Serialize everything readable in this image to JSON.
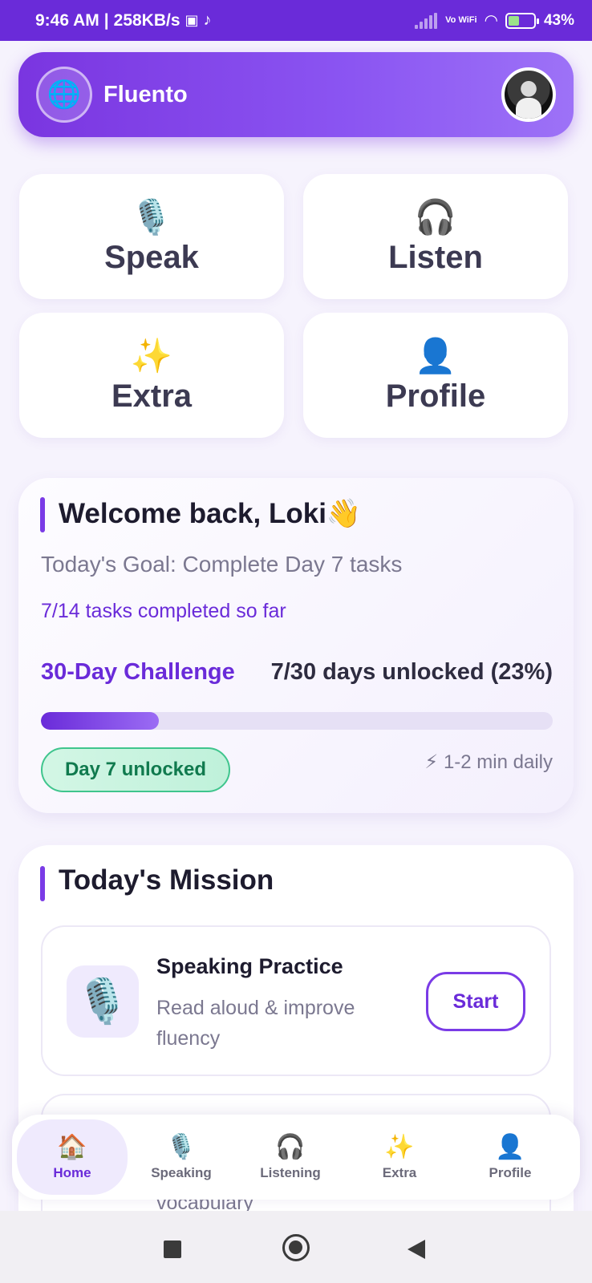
{
  "status_bar": {
    "time": "9:46 AM",
    "speed": "258KB/s",
    "network": "Vo WiFi",
    "battery": "43%",
    "battery_level": 0.43
  },
  "header": {
    "app_name": "Fluento",
    "logo_icon": "globe-icon",
    "avatar_icon": "user-avatar"
  },
  "quick_actions": [
    {
      "label": "Speak",
      "icon": "🎙️",
      "icon_name": "microphone-icon"
    },
    {
      "label": "Listen",
      "icon": "🎧",
      "icon_name": "headphones-icon"
    },
    {
      "label": "Extra",
      "icon": "✨",
      "icon_name": "sparkles-icon"
    },
    {
      "label": "Profile",
      "icon": "👤",
      "icon_name": "person-icon"
    }
  ],
  "welcome": {
    "title": "Welcome back, Loki👋",
    "goal": "Today's Goal: Complete Day 7 tasks",
    "tasks_done": "7/14 tasks completed so far",
    "challenge_label": "30-Day Challenge",
    "unlocked_text": "7/30 days unlocked (23%)",
    "progress": 0.23,
    "day_badge": "Day 7 unlocked",
    "daily_time": "⚡ 1-2 min daily"
  },
  "mission": {
    "title": "Today's Mission",
    "items": [
      {
        "name": "Speaking Practice",
        "desc": "Read aloud & improve fluency",
        "button": "Start",
        "icon": "🎙️",
        "icon_name": "microphone-icon"
      },
      {
        "name": "",
        "desc": "vocabulary",
        "button": "",
        "icon": "",
        "icon_name": ""
      }
    ]
  },
  "bottom_nav": [
    {
      "label": "Home",
      "icon": "🏠",
      "icon_name": "home-icon",
      "active": true
    },
    {
      "label": "Speaking",
      "icon": "🎙️",
      "icon_name": "microphone-icon",
      "active": false
    },
    {
      "label": "Listening",
      "icon": "🎧",
      "icon_name": "headphones-icon",
      "active": false
    },
    {
      "label": "Extra",
      "icon": "✨",
      "icon_name": "sparkles-icon",
      "active": false
    },
    {
      "label": "Profile",
      "icon": "👤",
      "icon_name": "person-icon",
      "active": false
    }
  ],
  "colors": {
    "accent": "#6a2bd9",
    "success": "#3fc58d",
    "background": "#f6f3fd"
  }
}
